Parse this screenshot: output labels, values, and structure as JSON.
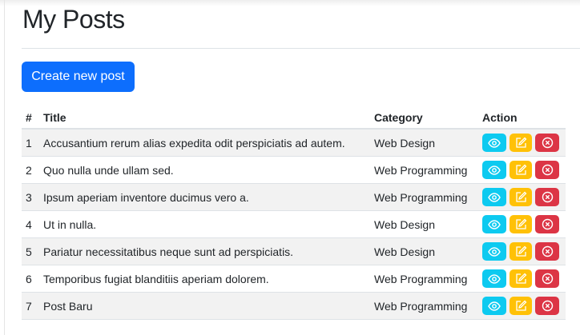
{
  "page": {
    "title": "My Posts",
    "create_label": "Create new post"
  },
  "table": {
    "headers": [
      "#",
      "Title",
      "Category",
      "Action"
    ],
    "rows": [
      {
        "num": "1",
        "title": "Accusantium rerum alias expedita odit perspiciatis ad autem.",
        "category": "Web Design"
      },
      {
        "num": "2",
        "title": "Quo nulla unde ullam sed.",
        "category": "Web Programming"
      },
      {
        "num": "3",
        "title": "Ipsum aperiam inventore ducimus vero a.",
        "category": "Web Programming"
      },
      {
        "num": "4",
        "title": "Ut in nulla.",
        "category": "Web Design"
      },
      {
        "num": "5",
        "title": "Pariatur necessitatibus neque sunt ad perspiciatis.",
        "category": "Web Design"
      },
      {
        "num": "6",
        "title": "Temporibus fugiat blanditiis aperiam dolorem.",
        "category": "Web Programming"
      },
      {
        "num": "7",
        "title": "Post Baru",
        "category": "Web Programming"
      }
    ],
    "actions": [
      {
        "icon": "eye-icon",
        "color": "#0dcaf0"
      },
      {
        "icon": "pencil-square-icon",
        "color": "#ffc107"
      },
      {
        "icon": "x-circle-icon",
        "color": "#dc3545"
      }
    ]
  }
}
